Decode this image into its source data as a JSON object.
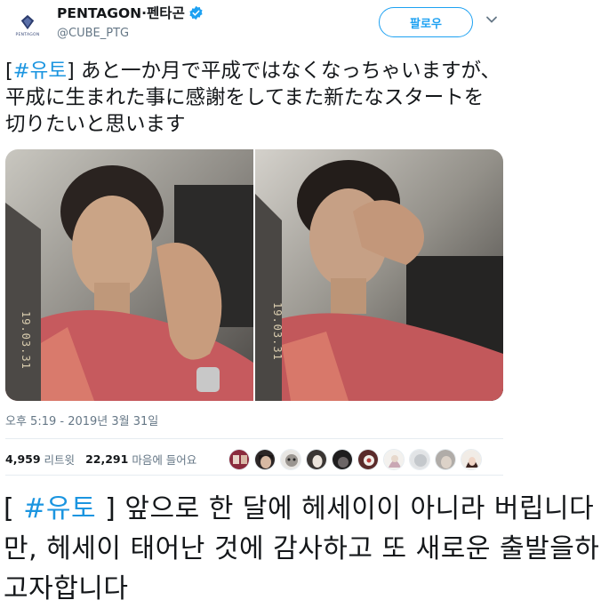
{
  "account": {
    "display_name": "PENTAGON·펜타곤",
    "handle": "@CUBE_PTG",
    "logo_text": "PENTAGON"
  },
  "actions": {
    "follow_label": "팔로우"
  },
  "tweet": {
    "hashtag": "#유토",
    "bracket_open": "[",
    "bracket_close": "]",
    "body": " あと一か月で平成ではなくなっちゃいますが、平成に生まれた事に感謝をしてまた新たなスタートを切りたいと思います",
    "photo1_overlay": "19.03.31",
    "photo2_overlay": "19.03.31",
    "timestamp": "오후 5:19 - 2019년 3월 31일"
  },
  "stats": {
    "retweets_count": "4,959",
    "retweets_label": "리트윗",
    "likes_count": "22,291",
    "likes_label": "마음에 들어요"
  },
  "translation": {
    "bracket_open": "[ ",
    "hashtag": "#유토",
    "bracket_close": " ]",
    "body": " 앞으로 한 달에 헤세이이 아니라 버립니다 만, 헤세이 태어난 것에 감사하고 또 새로운 출발을하고자합니다"
  },
  "colors": {
    "accent": "#1da1f2",
    "hashtag": "#1b95e0",
    "secondary_text": "#657786"
  },
  "icons": {
    "verified": "verified-badge-icon",
    "caret": "chevron-down-icon"
  }
}
